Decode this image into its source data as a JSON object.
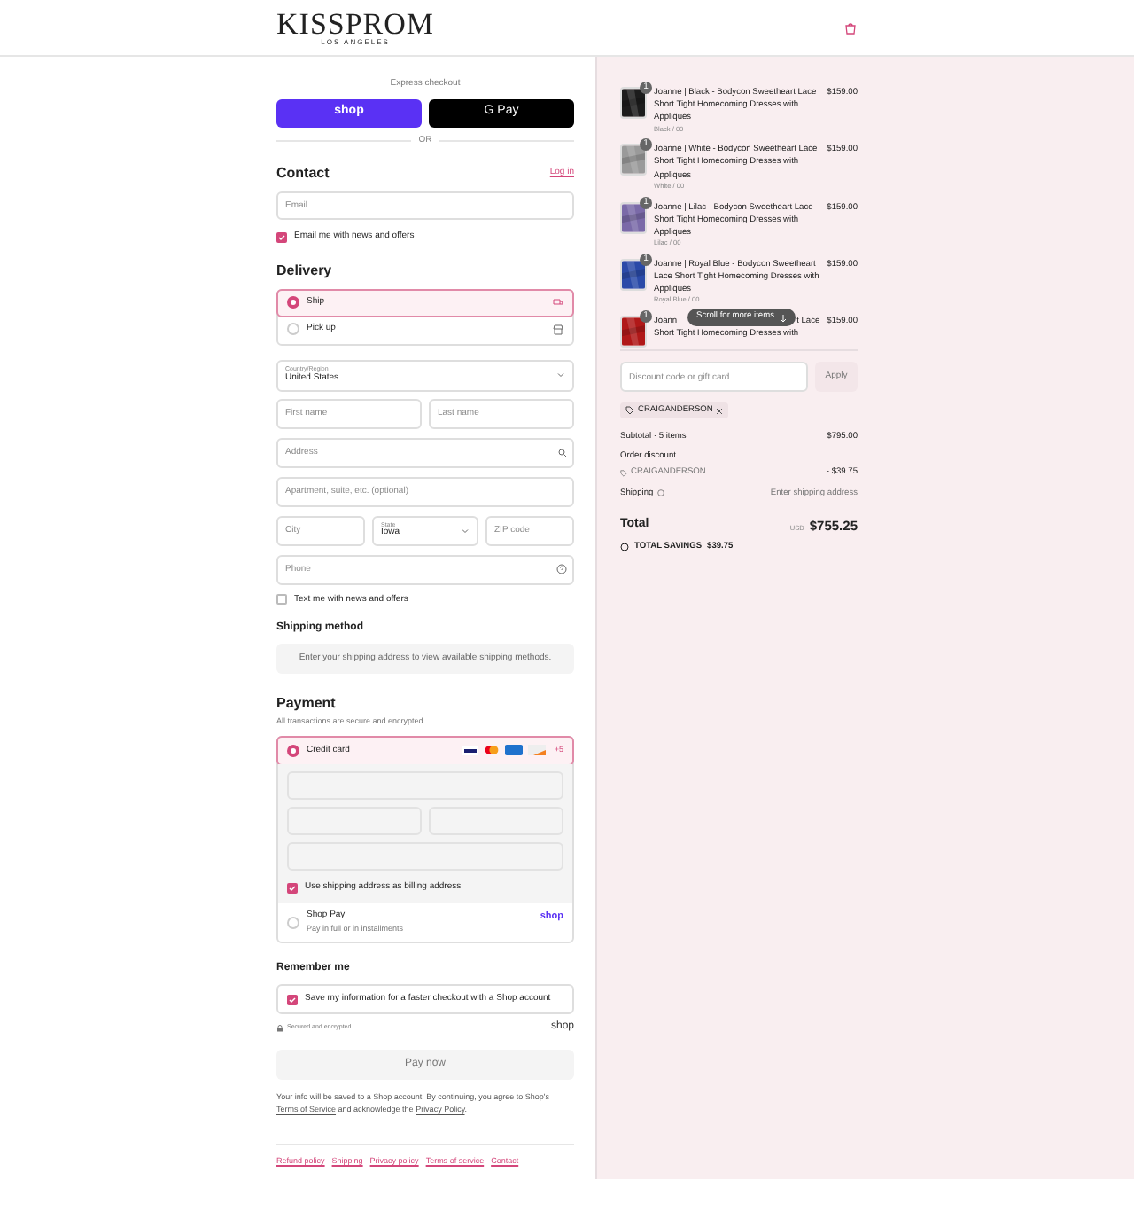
{
  "header": {
    "logo": "KISSPROM",
    "logo_sub": "LOS ANGELES"
  },
  "express": {
    "title": "Express checkout",
    "shop_button": "shop",
    "gpay_button": "G Pay",
    "or": "OR"
  },
  "contact": {
    "title": "Contact",
    "login_link": "Log in",
    "email": {
      "placeholder": "Email"
    },
    "news": {
      "label": "Email me with news and offers",
      "checked": true
    }
  },
  "delivery": {
    "title": "Delivery",
    "methods": [
      {
        "label": "Ship",
        "selected": true,
        "kind": "ship"
      },
      {
        "label": "Pick up",
        "selected": false,
        "kind": "pickup"
      }
    ],
    "country": {
      "label": "Country/Region",
      "value": "United States"
    },
    "first_name": {
      "placeholder": "First name"
    },
    "last_name": {
      "placeholder": "Last name"
    },
    "address": {
      "placeholder": "Address"
    },
    "apartment": {
      "placeholder": "Apartment, suite, etc. (optional)"
    },
    "city": {
      "placeholder": "City"
    },
    "state": {
      "label": "State",
      "value": "Iowa"
    },
    "zip": {
      "placeholder": "ZIP code"
    },
    "phone": {
      "placeholder": "Phone"
    },
    "text_me": {
      "label": "Text me with news and offers",
      "checked": false
    }
  },
  "shipping_method": {
    "title": "Shipping method",
    "message": "Enter your shipping address to view available shipping methods."
  },
  "payment": {
    "title": "Payment",
    "subtitle": "All transactions are secure and encrypted.",
    "options": [
      {
        "label": "Credit card",
        "selected": true,
        "kind": "card",
        "more": "+5"
      },
      {
        "label": "Shop Pay",
        "sublabel": "Pay in full or in installments",
        "selected": false,
        "kind": "shoppay",
        "badge": "shop"
      }
    ],
    "billing": {
      "label": "Use shipping address as billing address",
      "checked": true
    }
  },
  "remember": {
    "title": "Remember me",
    "save": {
      "label": "Save my information for a faster checkout with a Shop account",
      "checked": true
    },
    "secure": "Secured and encrypted",
    "shop_logo": "shop"
  },
  "pay_button": "Pay now",
  "legal_parts": [
    "Your info will be saved to a Shop account. By continuing, you agree to Shop's ",
    "Terms of Service",
    " and acknowledge the ",
    "Privacy Policy",
    "."
  ],
  "footer_links": [
    "Refund policy",
    "Shipping",
    "Privacy policy",
    "Terms of service",
    "Contact"
  ],
  "cart": {
    "items": [
      {
        "title": "Joanne | Black - Bodycon Sweetheart Lace Short Tight Homecoming Dresses with Appliques",
        "variant": "Black / 00",
        "price": "$159.00",
        "qty": "1",
        "color": "#1c1c1c"
      },
      {
        "title": "Joanne | White - Bodycon Sweetheart Lace Short Tight Homecoming Dresses with Appliques",
        "variant": "White / 00",
        "price": "$159.00",
        "qty": "1",
        "color": "#9a9a9a"
      },
      {
        "title": "Joanne | Lilac - Bodycon Sweetheart Lace Short Tight Homecoming Dresses with Appliques",
        "variant": "Lilac / 00",
        "price": "$159.00",
        "qty": "1",
        "color": "#7a6aa8"
      },
      {
        "title": "Joanne | Royal Blue - Bodycon Sweetheart Lace Short Tight Homecoming Dresses with Appliques",
        "variant": "Royal Blue / 00",
        "price": "$159.00",
        "qty": "1",
        "color": "#2a4aa8"
      }
    ],
    "partial_item": {
      "title_start": "Joann",
      "title_end": "t Lace",
      "line2": "Short Tight Homecoming Dresses with",
      "price": "$159.00",
      "qty": "1",
      "color": "#b01818"
    },
    "scroll_hint": "Scroll for more items",
    "discount": {
      "placeholder": "Discount code or gift card",
      "apply": "Apply",
      "tag": "CRAIGANDERSON"
    },
    "subtotal": {
      "label": "Subtotal · 5 items",
      "value": "$795.00"
    },
    "order_discount": {
      "label": "Order discount",
      "code": "CRAIGANDERSON",
      "value": "- $39.75"
    },
    "shipping": {
      "label": "Shipping",
      "value": "Enter shipping address"
    },
    "total": {
      "label": "Total",
      "currency": "USD",
      "value": "$755.25"
    },
    "savings": {
      "label": "TOTAL SAVINGS",
      "value": "$39.75"
    }
  }
}
